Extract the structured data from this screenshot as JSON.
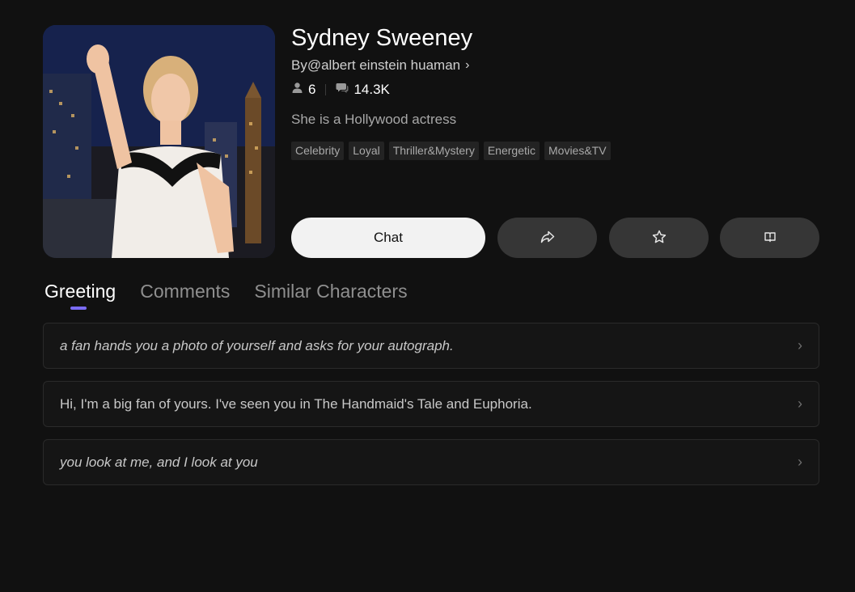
{
  "character": {
    "name": "Sydney Sweeney",
    "author": "By@albert einstein huaman",
    "followers": "6",
    "chats": "14.3K",
    "description": "She is a Hollywood actress",
    "tags": [
      "Celebrity",
      "Loyal",
      "Thriller&Mystery",
      "Energetic",
      "Movies&TV"
    ]
  },
  "actions": {
    "chat_label": "Chat",
    "share_icon": "share-icon",
    "favorite_icon": "star-icon",
    "report_icon": "report-icon"
  },
  "tabs": [
    {
      "label": "Greeting",
      "active": true
    },
    {
      "label": "Comments",
      "active": false
    },
    {
      "label": "Similar Characters",
      "active": false
    }
  ],
  "greetings": [
    {
      "text": "a fan hands you a photo of yourself and asks for your autograph.",
      "italic": true
    },
    {
      "text": "Hi, I'm a big fan of yours. I've seen you in The Handmaid's Tale and Euphoria.",
      "italic": false
    },
    {
      "text": "you look at me, and I look at you",
      "italic": true
    }
  ],
  "colors": {
    "background": "#111111",
    "accent": "#7b6cf6",
    "chat_button": "#f2f2f2",
    "secondary_button": "#363636"
  }
}
